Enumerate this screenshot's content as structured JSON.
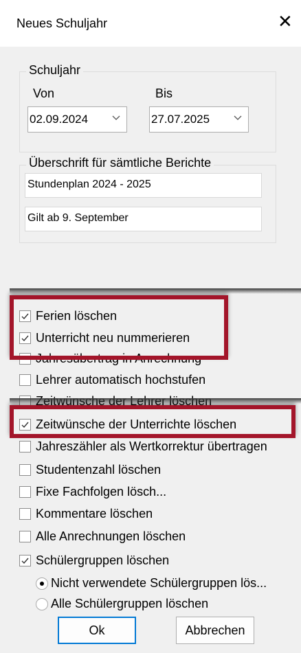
{
  "window": {
    "title": "Neues Schuljahr",
    "close_glyph": "✕"
  },
  "schuljahr": {
    "legend": "Schuljahr",
    "von_label": "Von",
    "bis_label": "Bis",
    "von_value": "02.09.2024",
    "bis_value": "27.07.2025"
  },
  "berichte": {
    "legend": "Überschrift für sämtliche Berichte",
    "line1": "Stundenplan 2024 - 2025",
    "line2": "Gilt ab 9. September"
  },
  "options": [
    {
      "label": "Ferien löschen",
      "checked": true
    },
    {
      "label": "Unterricht neu nummerieren",
      "checked": true
    },
    {
      "label": "Jahresübertrag in Anrechnung",
      "checked": false
    },
    {
      "label": "Lehrer automatisch hochstufen",
      "checked": false
    },
    {
      "label": "Zeitwünsche der Lehrer löschen",
      "checked": false
    },
    {
      "label": "Zeitwünsche der Unterrichte löschen",
      "checked": true
    },
    {
      "label": "Jahreszähler als Wertkorrektur übertragen",
      "checked": false
    },
    {
      "label": "Studentenzahl löschen",
      "checked": false
    },
    {
      "label": "Fixe Fachfolgen lösch...",
      "checked": false
    },
    {
      "label": "Kommentare löschen",
      "checked": false
    },
    {
      "label": "Alle Anrechnungen löschen",
      "checked": false
    },
    {
      "label": "Schülergruppen löschen",
      "checked": true
    }
  ],
  "radios": [
    {
      "label": "Nicht verwendete Schülergruppen lös...",
      "selected": true
    },
    {
      "label": "Alle Schülergruppen löschen",
      "selected": false
    }
  ],
  "buttons": {
    "ok": "Ok",
    "cancel": "Abbrechen"
  },
  "colors": {
    "highlight": "#a3152a",
    "accent": "#0078d4",
    "dialog_bg": "#f0f0f0"
  }
}
